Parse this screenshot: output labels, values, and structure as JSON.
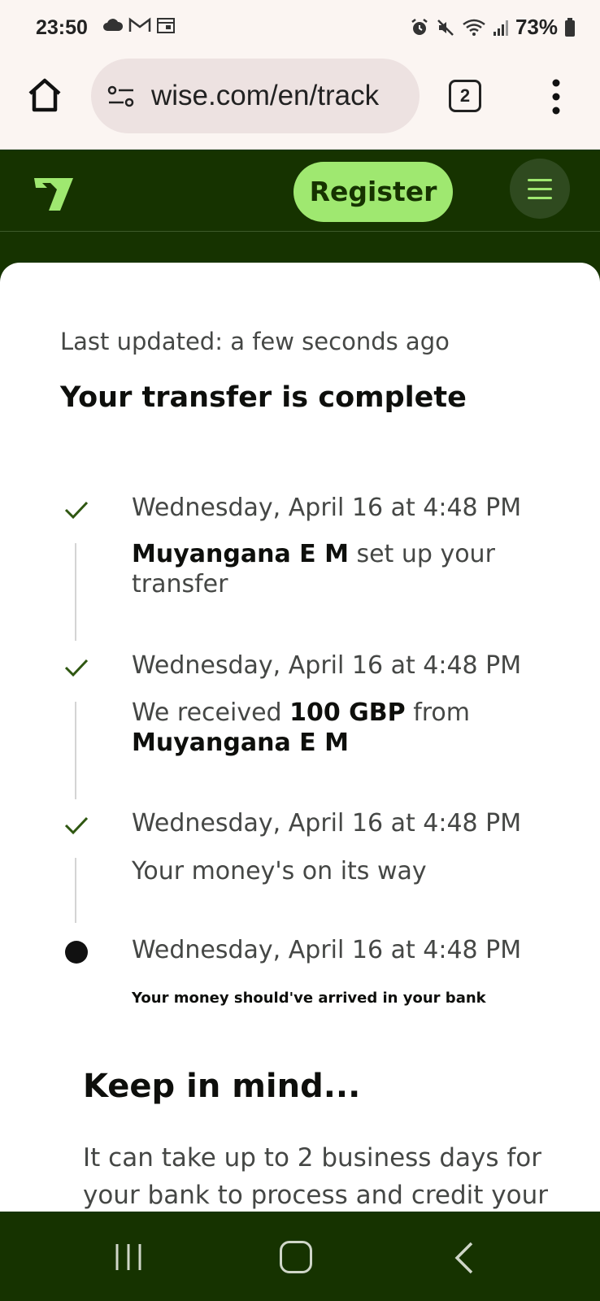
{
  "status_bar": {
    "time": "23:50",
    "left_icons": [
      "cloud-icon",
      "gmail-icon",
      "calendar-icon"
    ],
    "right_icons": [
      "alarm-icon",
      "mute-icon",
      "wifi-icon",
      "signal-icon",
      "battery-icon"
    ],
    "battery": "73%"
  },
  "browser": {
    "url": "wise.com/en/track",
    "tab_count": "2"
  },
  "header": {
    "register_label": "Register"
  },
  "transfer": {
    "last_updated": "Last updated: a few seconds ago",
    "title": "Your transfer is complete",
    "steps": [
      {
        "date": "Wednesday, April 16 at 4:48 PM",
        "status": "done",
        "bold1": "Muyangana E M",
        "text1": " set up your transfer"
      },
      {
        "date": "Wednesday, April 16 at 4:48 PM",
        "status": "done",
        "text1": "We received ",
        "bold1": "100 GBP",
        "text2": " from ",
        "bold2": "Muyangana E M"
      },
      {
        "date": "Wednesday, April 16 at 4:48 PM",
        "status": "done",
        "text1": "Your money's on its way"
      },
      {
        "date": "Wednesday, April 16 at 4:48 PM",
        "status": "current",
        "text1": "Your money should've arrived in your bank"
      }
    ]
  },
  "keep_in_mind": {
    "title": "Keep in mind...",
    "text": "It can take up to 2 business days for your bank to process and credit your"
  },
  "colors": {
    "forest_green": "#163300",
    "bright_green": "#9fe870",
    "check_green": "#2f5711"
  }
}
